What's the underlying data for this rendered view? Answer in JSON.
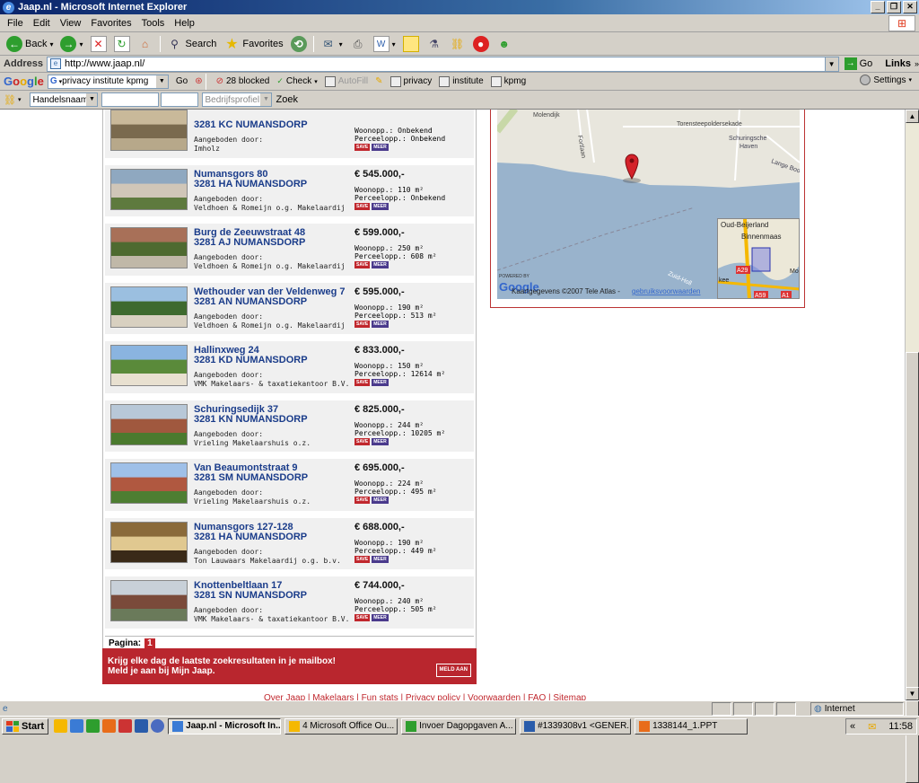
{
  "window": {
    "title": "Jaap.nl - Microsoft Internet Explorer"
  },
  "menu": [
    "File",
    "Edit",
    "View",
    "Favorites",
    "Tools",
    "Help"
  ],
  "toolbar": {
    "back": "Back",
    "search": "Search",
    "favorites": "Favorites"
  },
  "address": {
    "label": "Address",
    "url": "http://www.jaap.nl/",
    "go": "Go",
    "links": "Links"
  },
  "google": {
    "logo": "Google",
    "query": "privacy institute kpmg",
    "go": "Go",
    "blocked": "28 blocked",
    "check": "Check",
    "autofill": "AutoFill",
    "terms": [
      "privacy",
      "institute",
      "kpmg"
    ],
    "settings": "Settings"
  },
  "bar4": {
    "select_value": "Handelsnaam",
    "bedrijf": "Bedrijfsprofiel €",
    "zoek": "Zoek"
  },
  "listings": [
    {
      "street": "",
      "city": "3281 KC NUMANSDORP",
      "offered_label": "Aangeboden door:",
      "agent": "Imholz",
      "price": "",
      "woon": "Woonopp.: Onbekend",
      "perc": "Perceelopp.: Onbekend"
    },
    {
      "street": "Numansgors 80",
      "city": "3281 HA NUMANSDORP",
      "offered_label": "Aangeboden door:",
      "agent": "Veldhoen & Romeijn o.g. Makelaardij",
      "price": "€ 545.000,-",
      "woon": "Woonopp.: 110 m²",
      "perc": "Perceelopp.: Onbekend"
    },
    {
      "street": "Burg de Zeeuwstraat 48",
      "city": "3281 AJ NUMANSDORP",
      "offered_label": "Aangeboden door:",
      "agent": "Veldhoen & Romeijn o.g. Makelaardij",
      "price": "€ 599.000,-",
      "woon": "Woonopp.: 250 m²",
      "perc": "Perceelopp.: 608 m²"
    },
    {
      "street": "Wethouder van der Veldenweg 7",
      "city": "3281 AN NUMANSDORP",
      "offered_label": "Aangeboden door:",
      "agent": "Veldhoen & Romeijn o.g. Makelaardij",
      "price": "€ 595.000,-",
      "woon": "Woonopp.: 190 m²",
      "perc": "Perceelopp.: 513 m²"
    },
    {
      "street": "Hallinxweg 24",
      "city": "3281 KD NUMANSDORP",
      "offered_label": "Aangeboden door:",
      "agent": "VMK Makelaars- & taxatiekantoor B.V.",
      "price": "€ 833.000,-",
      "woon": "Woonopp.: 150 m²",
      "perc": "Perceelopp.: 12614 m²"
    },
    {
      "street": "Schuringsedijk 37",
      "city": "3281 KN NUMANSDORP",
      "offered_label": "Aangeboden door:",
      "agent": "Vrieling Makelaarshuis o.z.",
      "price": "€ 825.000,-",
      "woon": "Woonopp.: 244 m²",
      "perc": "Perceelopp.: 10205 m²"
    },
    {
      "street": "Van Beaumontstraat 9",
      "city": "3281 SM NUMANSDORP",
      "offered_label": "Aangeboden door:",
      "agent": "Vrieling Makelaarshuis o.z.",
      "price": "€ 695.000,-",
      "woon": "Woonopp.: 224 m²",
      "perc": "Perceelopp.: 495 m²"
    },
    {
      "street": "Numansgors 127-128",
      "city": "3281 HA NUMANSDORP",
      "offered_label": "Aangeboden door:",
      "agent": "Ton Lauwaars Makelaardij o.g. b.v.",
      "price": "€ 688.000,-",
      "woon": "Woonopp.: 190 m²",
      "perc": "Perceelopp.: 449 m²"
    },
    {
      "street": "Knottenbeltlaan 17",
      "city": "3281 SN NUMANSDORP",
      "offered_label": "Aangeboden door:",
      "agent": "VMK Makelaars- & taxatiekantoor B.V.",
      "price": "€ 744.000,-",
      "woon": "Woonopp.: 240 m²",
      "perc": "Perceelopp.: 505 m²"
    }
  ],
  "tags": {
    "save": "SAVE",
    "meer": "MEER"
  },
  "pagination": {
    "label": "Pagina:",
    "current": "1"
  },
  "mailbox": {
    "line1": "Krijg elke dag de laatste zoekresultaten in je mailbox!",
    "line2": "Meld je aan bij Mijn Jaap.",
    "button": "MELD AAN"
  },
  "footer": "Over Jaap | Makelaars | Fun stats | Privacy policy | Voorwaarden | FAQ | Sitemap",
  "map": {
    "labels": {
      "molendijk": "Molendijk",
      "torensteepolder": "Torensteepoldersekade",
      "schuringsche": "Schuringsche",
      "haven": "Haven",
      "langeboo": "Lange Boo",
      "fortlaan": "Fortlaan",
      "zuidholl": "Zuid-Holl",
      "powered": "POWERED BY",
      "google": "Google",
      "copyright": "Kaartgegevens ©2007 Tele Atlas -",
      "terms_link": "gebruiksvoorwaarden"
    },
    "inset": {
      "town1": "Oud-Beijerland",
      "town2": "Binnenmaas",
      "road1": "A29",
      "road2": "A59",
      "road3": "A1",
      "town3": "kee",
      "town4": "Mo"
    }
  },
  "status": {
    "zone": "Internet"
  },
  "taskbar": {
    "start": "Start",
    "tasks": [
      "Jaap.nl - Microsoft In...",
      "4 Microsoft Office Ou...",
      "Invoer Dagopgaven A...",
      "#1339308v1 <GENER...",
      "1338144_1.PPT"
    ],
    "clock": "11:58"
  }
}
